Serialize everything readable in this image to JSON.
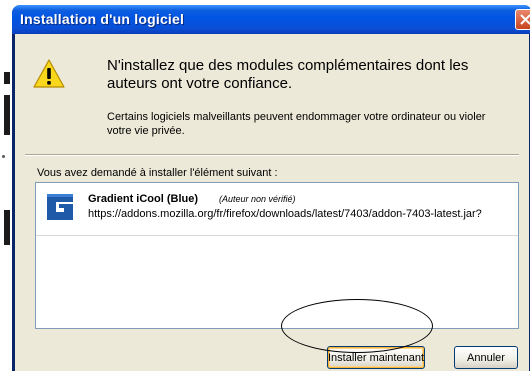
{
  "window": {
    "title": "Installation d'un logiciel",
    "accent_color": "#0054e3"
  },
  "warning": {
    "icon": "warning-icon",
    "heading": "N'installez que des modules complémentaires dont les auteurs ont votre confiance.",
    "text": "Certains logiciels malveillants peuvent endommager votre ordinateur ou violer votre vie privée."
  },
  "install_list": {
    "label": "Vous avez demandé à installer l'élément suivant :",
    "items": [
      {
        "icon": "gradient-icool-logo-icon",
        "name": "Gradient iCool (Blue)",
        "author_note": "(Auteur non vérifié)",
        "url": "https://addons.mozilla.org/fr/firefox/downloads/latest/7403/addon-7403-latest.jar?"
      }
    ]
  },
  "buttons": {
    "install": "Installer maintenant",
    "cancel": "Annuler"
  }
}
